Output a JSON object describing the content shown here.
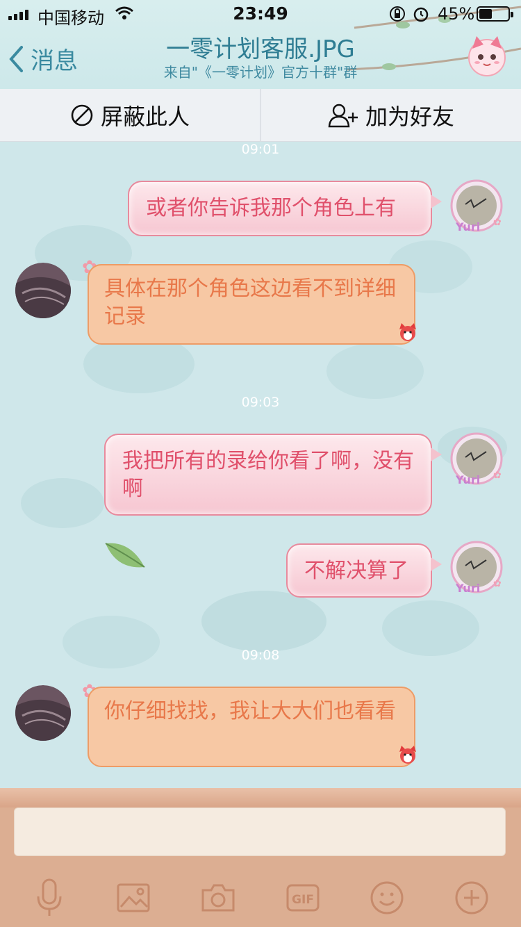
{
  "status_bar": {
    "carrier": "中国移动",
    "time": "23:49",
    "battery_percent_label": "45%",
    "battery_level": 0.45
  },
  "header": {
    "back_label": "消息",
    "title": "一零计划客服.JPG",
    "subtitle": "来自\"《一零计划》官方十群\"群"
  },
  "actions": {
    "block_label": "屏蔽此人",
    "add_friend_label": "加为好友"
  },
  "chat": {
    "timestamps": [
      "09:01",
      "09:03",
      "09:08"
    ],
    "messages": [
      {
        "side": "out",
        "text": "或者你告诉我那个角色上有"
      },
      {
        "side": "in",
        "text": "具体在那个角色这边看不到详细记录"
      },
      {
        "side": "out",
        "text": "我把所有的录给你看了啊，没有啊"
      },
      {
        "side": "out",
        "text": "不解决算了"
      },
      {
        "side": "in",
        "text": "你仔细找找，我让大大们也看看"
      }
    ]
  },
  "toolbar": {
    "icons": [
      "microphone-icon",
      "image-icon",
      "camera-icon",
      "gif-icon",
      "emoji-icon",
      "plus-icon"
    ],
    "gif_label": "GIF"
  },
  "colors": {
    "header_bg": "#d3ebec",
    "title": "#2f7d93",
    "outgoing_text": "#e0506b",
    "incoming_text": "#e8784a",
    "incoming_bubble": "#f7c8a4",
    "input_panel": "#dcae92"
  }
}
